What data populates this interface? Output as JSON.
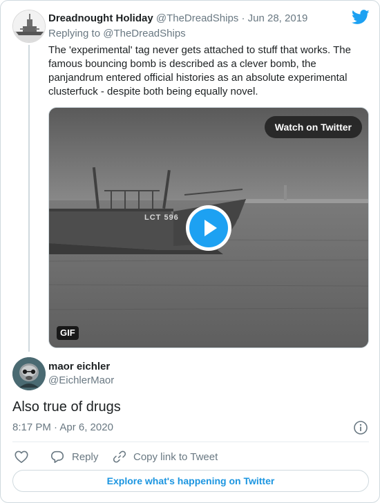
{
  "parent_tweet": {
    "display_name": "Dreadnought Holiday",
    "handle": "@TheDreadShips",
    "separator": "·",
    "date": "Jun 28, 2019",
    "replying_to": "Replying to @TheDreadShips",
    "text": "The 'experimental' tag never gets attached to stuff that works. The famous bouncing bomb is described as a clever bomb, the panjandrum entered official histories as an absolute experimental clusterfuck - despite both being equally novel.",
    "media": {
      "watch_label": "Watch on Twitter",
      "badge": "GIF",
      "hull_text": "LCT 596"
    }
  },
  "tweet": {
    "display_name": "maor eichler",
    "handle": "@EichlerMaor",
    "text": "Also true of drugs",
    "timestamp": "8:17 PM · Apr 6, 2020"
  },
  "actions": {
    "reply_label": "Reply",
    "copy_label": "Copy link to Tweet"
  },
  "footer": {
    "explore_label": "Explore what's happening on Twitter"
  },
  "icons": {
    "twitter": "twitter-bird-icon",
    "play": "play-icon",
    "info": "info-icon",
    "like": "heart-icon",
    "reply": "speech-bubble-icon",
    "copy_link": "link-icon"
  },
  "colors": {
    "brand_blue": "#1da1f2",
    "link_blue": "#1b95e0",
    "muted_text": "#697882",
    "primary_text": "#1c2022",
    "border": "#cfd9de"
  }
}
